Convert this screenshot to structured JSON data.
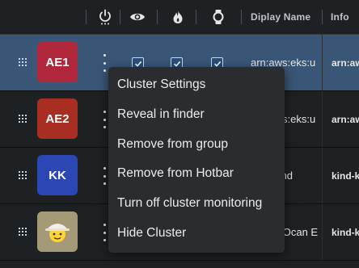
{
  "header": {
    "columns": [
      {
        "type": "icon",
        "icon": "power-icon"
      },
      {
        "type": "icon",
        "icon": "eye-icon"
      },
      {
        "type": "icon",
        "icon": "flame-icon"
      },
      {
        "type": "icon",
        "icon": "watch-icon"
      },
      {
        "type": "text",
        "label": "Diplay Name"
      },
      {
        "type": "text",
        "label": "Info"
      }
    ]
  },
  "rows": [
    {
      "avatar_text": "AE1",
      "avatar_color": "#b0263a",
      "selected": true,
      "display_name": "arn:aws:eks:u",
      "info": "arn:aws:"
    },
    {
      "avatar_text": "AE2",
      "avatar_color": "#a82e22",
      "selected": false,
      "display_name": "arn:aws:eks:u",
      "info": "arn:aws:"
    },
    {
      "avatar_text": "KK",
      "avatar_color": "#2c46b4",
      "selected": false,
      "display_name": "kind-kind",
      "info": "kind-k"
    },
    {
      "avatar_text": "",
      "avatar_color": "#a59a78",
      "avatar_icon": "person-with-hat-icon",
      "selected": false,
      "display_name": "Digital Ocan E",
      "info": "kind-k"
    }
  ],
  "context_menu": {
    "items": [
      "Cluster Settings",
      "Reveal in finder",
      "Remove from group",
      "Remove from Hotbar",
      "Turn off cluster monitoring",
      "Hide Cluster"
    ]
  },
  "colors": {
    "background": "#1e2124",
    "selected_row": "#3a5677",
    "menu_background": "#2a2c30"
  }
}
